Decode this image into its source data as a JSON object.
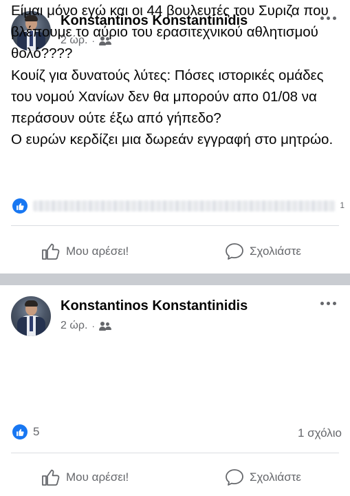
{
  "posts": [
    {
      "author": "Konstantinos Konstantinidis",
      "time": "2 ώρ.",
      "separator": "·",
      "text": "Κουίζ για δυνατούς λύτες: Πόσες ιστορικές ομάδες του νομού Χανίων δεν θα μπορούν απο 01/08 να περάσουν ούτε έξω από γήπεδο?\nΟ ευρών κερδίζει μια δωρεάν εγγραφή στο μητρώο.",
      "reaction_tail": "1",
      "like_label": "Μου αρέσει!",
      "comment_label": "Σχολιάστε"
    },
    {
      "author": "Konstantinos Konstantinidis",
      "time": "2 ώρ.",
      "separator": "·",
      "text": "Είμαι μόνο εγώ και οι 44 βουλευτές του Συριζα που βλέπουμε το αύριο του ερασιτεχνικού αθλητισμού θολό????",
      "reaction_count": "5",
      "comment_count": "1 σχόλιο",
      "like_label": "Μου αρέσει!",
      "comment_label": "Σχολιάστε"
    }
  ],
  "colors": {
    "like_blue": "#1877f2",
    "secondary_text": "#65676b",
    "divider_band": "#c9ccd1"
  },
  "icons": [
    "like-badge-icon",
    "friends-icon",
    "more-options-icon",
    "thumbs-up-icon",
    "comment-bubble-icon"
  ]
}
